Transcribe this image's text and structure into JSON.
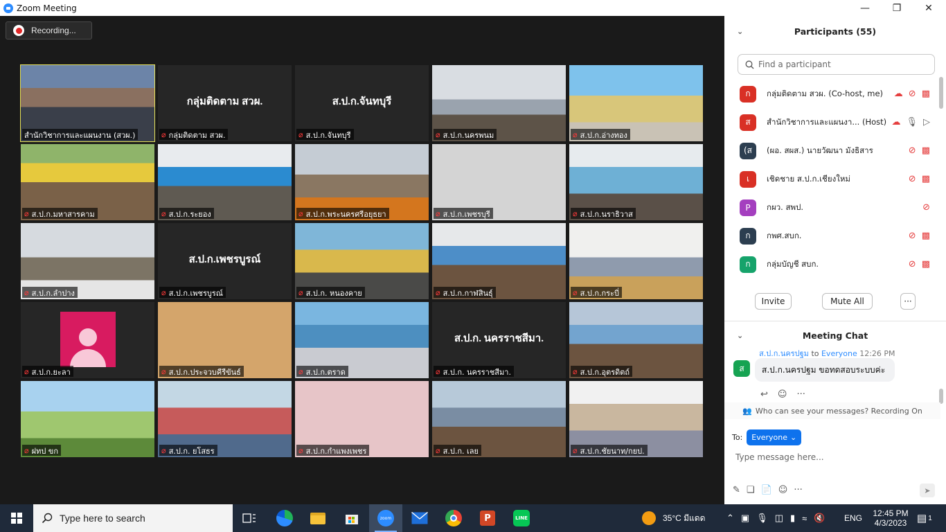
{
  "window": {
    "title": "Zoom Meeting",
    "minimize_glyph": "—",
    "restore_glyph": "❐",
    "close_glyph": "✕"
  },
  "recording": {
    "label": "Recording..."
  },
  "videos": [
    {
      "label": "สำนักวิชาการและแผนงาน (สวผ.)",
      "center": "",
      "active": true
    },
    {
      "label": "กลุ่มติดตาม สวผ.",
      "center": "กลุ่มติดตาม สวผ."
    },
    {
      "label": "ส.ป.ก.จันทบุรี",
      "center": "ส.ป.ก.จันทบุรี"
    },
    {
      "label": "ส.ป.ก.นครพนม",
      "center": ""
    },
    {
      "label": "ส.ป.ก.อ่างทอง",
      "center": ""
    },
    {
      "label": "ส.ป.ก.มหาสารคาม",
      "center": ""
    },
    {
      "label": "ส.ป.ก.ระยอง",
      "center": ""
    },
    {
      "label": "ส.ป.ก.พระนครศรีอยุธยา",
      "center": ""
    },
    {
      "label": "ส.ป.ก.เพชรบุรี",
      "center": ""
    },
    {
      "label": "ส.ป.ก.นราธิวาส",
      "center": ""
    },
    {
      "label": "ส.ป.ก.ลำปาง",
      "center": ""
    },
    {
      "label": "ส.ป.ก.เพชรบูรณ์",
      "center": "ส.ป.ก.เพชรบูรณ์"
    },
    {
      "label": "ส.ป.ก. หนองคาย",
      "center": ""
    },
    {
      "label": "ส.ป.ก.กาฬสินธุ์",
      "center": ""
    },
    {
      "label": "ส.ป.ก.กระบี่",
      "center": ""
    },
    {
      "label": "ส.ป.ก.ยะลา",
      "center": ""
    },
    {
      "label": "ส.ป.ก.ประจวบคีรีขันธ์",
      "center": ""
    },
    {
      "label": "ส.ป.ก.ตราด",
      "center": ""
    },
    {
      "label": "ส.ป.ก. นครราชสีมา.",
      "center": "ส.ป.ก. นครราชสีมา."
    },
    {
      "label": "ส.ป.ก.อุตรดิตถ์",
      "center": ""
    },
    {
      "label": "ฝทป ขก",
      "center": ""
    },
    {
      "label": "ส.ป.ก. ยโสธร",
      "center": ""
    },
    {
      "label": "ส.ป.ก.กำแพงเพชร",
      "center": ""
    },
    {
      "label": "ส.ป.ก. เลย",
      "center": ""
    },
    {
      "label": "ส.ป.ก.ชัยนาท/กยป.",
      "center": ""
    }
  ],
  "participants": {
    "title": "Participants (55)",
    "search_placeholder": "Find a participant",
    "items": [
      {
        "initial": "ก",
        "color": "#d93025",
        "name": "กลุ่มติดตาม สวผ. (Co-host, me)",
        "rec": true,
        "mic": "muted",
        "video": "off"
      },
      {
        "initial": "ส",
        "color": "#d93025",
        "name": "สำนักวิชาการและแผนงา... (Host)",
        "rec": true,
        "mic": "on",
        "video": "on"
      },
      {
        "initial": "(ส",
        "color": "#2c3e50",
        "name": "(ผอ. สผส.) นายวัฒนา มังธิสาร",
        "rec": false,
        "mic": "muted",
        "video": "off"
      },
      {
        "initial": "เ",
        "color": "#d93025",
        "name": "เชิดชาย ส.ป.ก.เชียงใหม่",
        "rec": false,
        "mic": "muted",
        "video": "off"
      },
      {
        "initial": "P",
        "color": "#a43fbf",
        "name": "กผว. สพป.",
        "rec": false,
        "mic": "muted",
        "video": "none"
      },
      {
        "initial": "ก",
        "color": "#2c3e50",
        "name": "กพศ.สบก.",
        "rec": false,
        "mic": "muted",
        "video": "off"
      },
      {
        "initial": "ก",
        "color": "#16a36b",
        "name": "กลุ่มบัญชี สบก.",
        "rec": false,
        "mic": "muted",
        "video": "off"
      }
    ],
    "invite_label": "Invite",
    "mute_all_label": "Mute All",
    "more_label": "···"
  },
  "chat": {
    "title": "Meeting Chat",
    "sender": "ส.ป.ก.นครปฐม",
    "to_word": "to",
    "recipient": "Everyone",
    "time": "12:26 PM",
    "avatar_initial": "ส",
    "message": "ส.ป.ก.นครปฐม ขอทดสอบระบบค่ะ",
    "notice": "Who can see your messages? Recording On",
    "to_label": "To:",
    "to_select": "Everyone",
    "input_placeholder": "Type message here..."
  },
  "taskbar": {
    "search_placeholder": "Type here to search",
    "weather": "35°C  มีแดด",
    "lang": "ENG",
    "time": "12:45 PM",
    "date": "4/3/2023",
    "notifications": "1"
  }
}
